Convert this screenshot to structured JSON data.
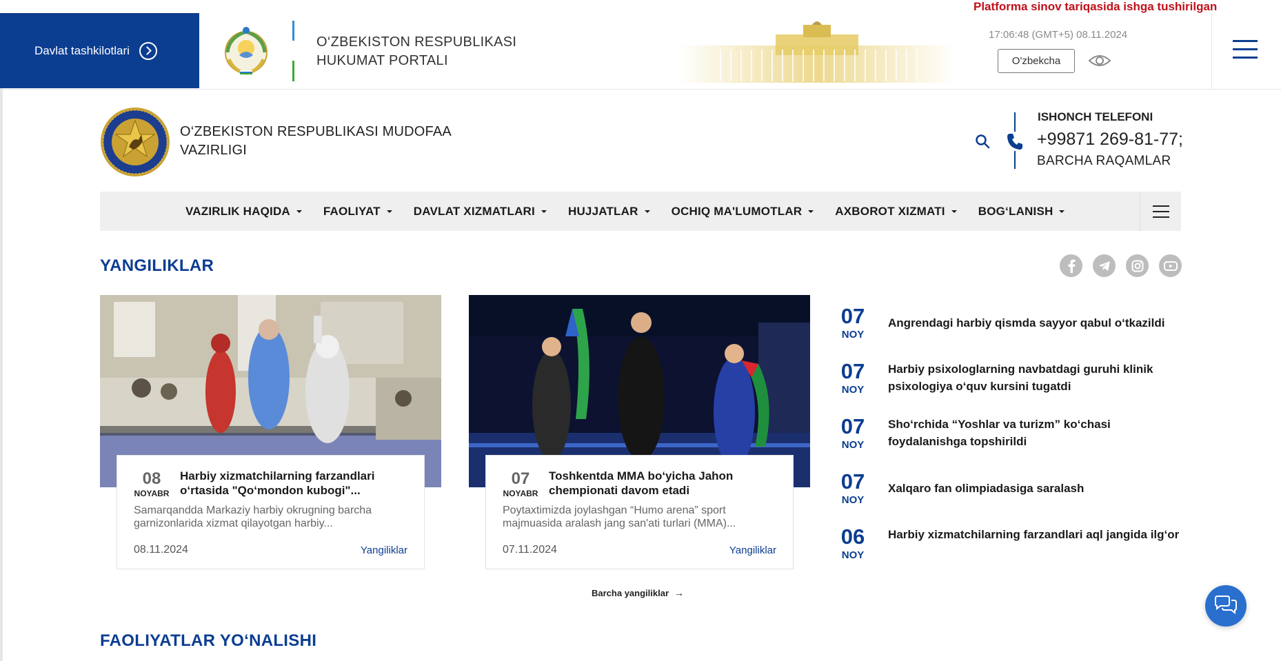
{
  "topbar": {
    "gov_orgs_label": "Davlat tashkilotlari",
    "gov_title_line1": "O‘ZBEKISTON RESPUBLIKASI",
    "gov_title_line2": "HUKUMAT PORTALI",
    "pilot_notice": "Platforma sinov tariqasida ishga tushirilgan",
    "clock": "17:06:48 (GMT+5) 08.11.2024",
    "language": "O'zbekcha",
    "accent_color": "#0b3d91",
    "notice_color": "#c0101a"
  },
  "header": {
    "ministry_line1": "O‘ZBEKISTON RESPUBLIKASI MUDOFAA",
    "ministry_line2": "VAZIRLIGI",
    "hotline_label": "ISHONCH TELEFONI",
    "hotline_number": "+99871 269-81-77;",
    "hotline_all": "BARCHA RAQAMLAR"
  },
  "nav": {
    "items": [
      {
        "label": "VAZIRLIK HAQIDA"
      },
      {
        "label": "FAOLIYAT"
      },
      {
        "label": "DAVLAT XIZMATLARI"
      },
      {
        "label": "HUJJATLAR"
      },
      {
        "label": "OCHIQ MA'LUMOTLAR"
      },
      {
        "label": "AXBOROT XIZMATI"
      },
      {
        "label": "BOG‘LANISH"
      }
    ]
  },
  "news": {
    "section_title": "YANGILIKLAR",
    "socials": [
      "facebook-icon",
      "telegram-icon",
      "instagram-icon",
      "youtube-icon"
    ],
    "cards": [
      {
        "day": "08",
        "month": "NOYABR",
        "title": "Harbiy xizmatchilarning farzandlari o‘rtasida \"Qo‘mondon kubogi\"...",
        "excerpt": "Samarqandda Markaziy harbiy okrugning barcha garnizonlarida xizmat qilayotgan harbiy...",
        "date": "08.11.2024",
        "category": "Yangiliklar"
      },
      {
        "day": "07",
        "month": "NOYABR",
        "title": "Toshkentda MMA bo‘yicha Jahon chempionati davom etadi",
        "excerpt": "Poytaxtimizda joylashgan “Humo arena” sport majmuasida aralash jang san'ati turlari (MMA)...",
        "date": "07.11.2024",
        "category": "Yangiliklar"
      }
    ],
    "list": [
      {
        "day": "07",
        "month": "NOY",
        "title": "Angrendagi harbiy qismda sayyor qabul o‘tkazildi"
      },
      {
        "day": "07",
        "month": "NOY",
        "title": "Harbiy psixologlarning navbatdagi guruhi klinik psixologiya o‘quv kursini tugatdi"
      },
      {
        "day": "07",
        "month": "NOY",
        "title": "Sho‘rchida “Yoshlar va turizm” ko‘chasi foydalanishga topshirildi"
      },
      {
        "day": "07",
        "month": "NOY",
        "title": "Xalqaro fan olimpiadasiga saralash"
      },
      {
        "day": "06",
        "month": "NOY",
        "title": "Harbiy xizmatchilarning farzandlari aql jangida ilg‘or"
      }
    ],
    "all_news_label": "Barcha yangiliklar",
    "all_news_arrow": "→"
  },
  "activities": {
    "section_title": "FAOLIYATLAR YO‘NALISHI"
  }
}
